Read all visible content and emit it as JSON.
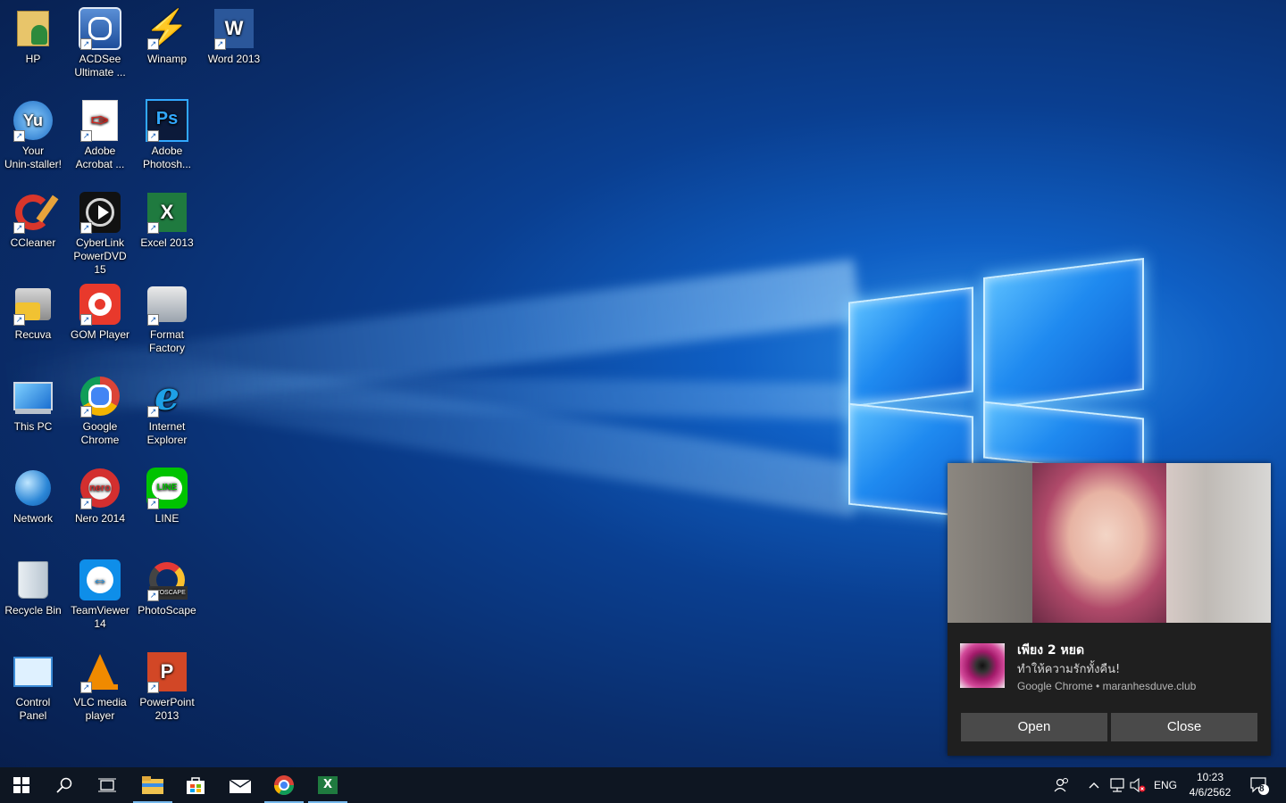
{
  "desktop": {
    "icons": [
      {
        "label_1": "HP",
        "label_2": ""
      },
      {
        "label_1": "ACDSee",
        "label_2": "Ultimate ..."
      },
      {
        "label_1": "Winamp",
        "label_2": ""
      },
      {
        "label_1": "Word 2013",
        "label_2": ""
      },
      {
        "label_1": "Your",
        "label_2": "Unin-staller!"
      },
      {
        "label_1": "Adobe",
        "label_2": "Acrobat ..."
      },
      {
        "label_1": "Adobe",
        "label_2": "Photosh..."
      },
      {
        "label_1": "CCleaner",
        "label_2": ""
      },
      {
        "label_1": "CyberLink",
        "label_2": "PowerDVD 15"
      },
      {
        "label_1": "Excel 2013",
        "label_2": ""
      },
      {
        "label_1": "Recuva",
        "label_2": ""
      },
      {
        "label_1": "GOM Player",
        "label_2": ""
      },
      {
        "label_1": "Format",
        "label_2": "Factory"
      },
      {
        "label_1": "This PC",
        "label_2": ""
      },
      {
        "label_1": "Google",
        "label_2": "Chrome"
      },
      {
        "label_1": "Internet",
        "label_2": "Explorer"
      },
      {
        "label_1": "Network",
        "label_2": ""
      },
      {
        "label_1": "Nero 2014",
        "label_2": ""
      },
      {
        "label_1": "LINE",
        "label_2": ""
      },
      {
        "label_1": "Recycle Bin",
        "label_2": ""
      },
      {
        "label_1": "TeamViewer",
        "label_2": "14"
      },
      {
        "label_1": "PhotoScape",
        "label_2": ""
      },
      {
        "label_1": "Control",
        "label_2": "Panel"
      },
      {
        "label_1": "VLC media",
        "label_2": "player"
      },
      {
        "label_1": "PowerPoint",
        "label_2": "2013"
      }
    ],
    "icon_glyphs": {
      "word": "W",
      "excel": "X",
      "photoshop": "Ps",
      "line": "LINE",
      "nero": "nero",
      "photoscape_text": "OTOSCAPE",
      "yu": "Yu"
    }
  },
  "notification": {
    "title": "เพียง 2 หยด",
    "message": "ทำให้ความรักทั้งคืน!",
    "attribution": "Google Chrome • maranhesduve.club",
    "open_label": "Open",
    "close_label": "Close"
  },
  "taskbar": {
    "language": "ENG",
    "time": "10:23",
    "date": "4/6/2562",
    "notification_count": "8",
    "excel_glyph": "X"
  },
  "colors": {
    "accent": "#76b9ed",
    "taskbar_bg": "#0e1622",
    "toast_bg": "#1f1f1f",
    "toast_button": "#4a4a4a"
  }
}
